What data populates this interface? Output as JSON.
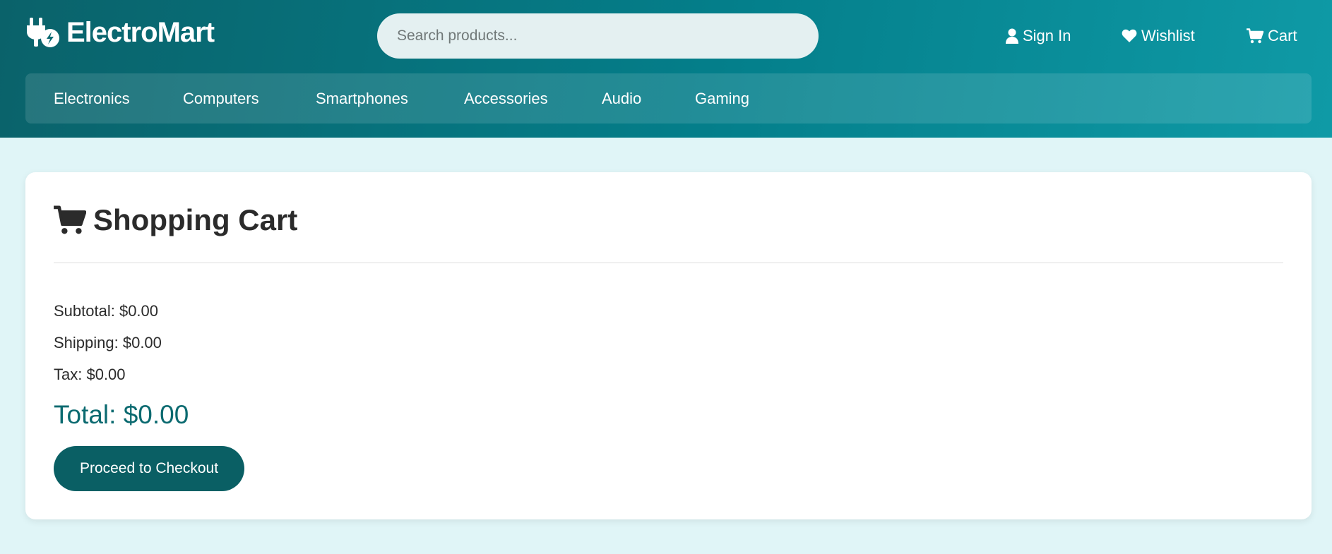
{
  "brand": {
    "name": "ElectroMart",
    "icon": "plug-bolt-icon"
  },
  "search": {
    "placeholder": "Search products..."
  },
  "header_links": {
    "sign_in": {
      "label": "Sign In",
      "icon": "user-icon"
    },
    "wishlist": {
      "label": "Wishlist",
      "icon": "heart-icon"
    },
    "cart": {
      "label": "Cart",
      "icon": "cart-icon"
    }
  },
  "nav": {
    "items": [
      {
        "label": "Electronics"
      },
      {
        "label": "Computers"
      },
      {
        "label": "Smartphones"
      },
      {
        "label": "Accessories"
      },
      {
        "label": "Audio"
      },
      {
        "label": "Gaming"
      }
    ]
  },
  "cart": {
    "title": "Shopping Cart",
    "title_icon": "cart-icon",
    "subtotal": "Subtotal: $0.00",
    "shipping": "Shipping: $0.00",
    "tax": "Tax: $0.00",
    "total": "Total: $0.00",
    "checkout_label": "Proceed to Checkout"
  },
  "colors": {
    "header_start": "#0a626a",
    "header_end": "#0f9aa6",
    "page_background": "#e0f5f7",
    "accent": "#0a5f64",
    "total_text": "#0b6a70"
  }
}
